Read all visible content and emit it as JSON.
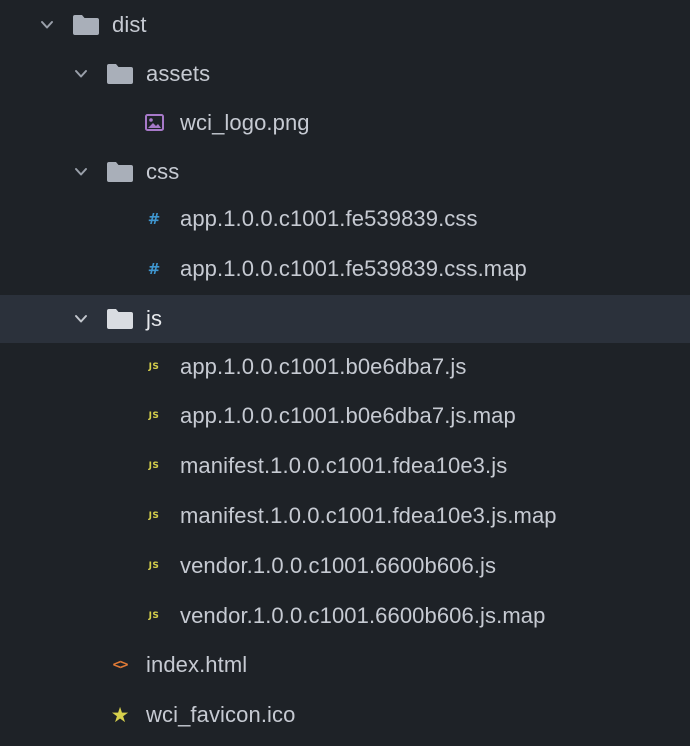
{
  "file_tree": {
    "root_folder": {
      "label": "dist"
    },
    "assets_folder": {
      "label": "assets",
      "files": [
        {
          "label": "wci_logo.png",
          "icon": "image-icon",
          "color": "#a779c9"
        }
      ]
    },
    "css_folder": {
      "label": "css",
      "files": [
        {
          "label": "app.1.0.0.c1001.fe539839.css",
          "icon": "hash-icon",
          "glyph": "#",
          "color": "#3f96cf"
        },
        {
          "label": "app.1.0.0.c1001.fe539839.css.map",
          "icon": "hash-icon",
          "glyph": "#",
          "color": "#3f96cf"
        }
      ]
    },
    "js_folder": {
      "label": "js",
      "selected": true,
      "files": [
        {
          "label": "app.1.0.0.c1001.b0e6dba7.js",
          "icon": "js-icon",
          "glyph": "JS",
          "color": "#d6d04c"
        },
        {
          "label": "app.1.0.0.c1001.b0e6dba7.js.map",
          "icon": "js-icon",
          "glyph": "JS",
          "color": "#d6d04c"
        },
        {
          "label": "manifest.1.0.0.c1001.fdea10e3.js",
          "icon": "js-icon",
          "glyph": "JS",
          "color": "#d6d04c"
        },
        {
          "label": "manifest.1.0.0.c1001.fdea10e3.js.map",
          "icon": "js-icon",
          "glyph": "JS",
          "color": "#d6d04c"
        },
        {
          "label": "vendor.1.0.0.c1001.6600b606.js",
          "icon": "js-icon",
          "glyph": "JS",
          "color": "#d6d04c"
        },
        {
          "label": "vendor.1.0.0.c1001.6600b606.js.map",
          "icon": "js-icon",
          "glyph": "JS",
          "color": "#d6d04c"
        }
      ]
    },
    "root_files": [
      {
        "label": "index.html",
        "icon": "code-icon",
        "glyph": "<>",
        "color": "#e07a36"
      },
      {
        "label": "wci_favicon.ico",
        "icon": "star-icon",
        "glyph": "★",
        "color": "#d6d04c"
      }
    ]
  },
  "colors": {
    "background": "#1e2227",
    "selected_row": "#2b313b",
    "text": "#c6cad2",
    "folder_icon": "#a9afb9",
    "chevron": "#9aa0aa"
  }
}
